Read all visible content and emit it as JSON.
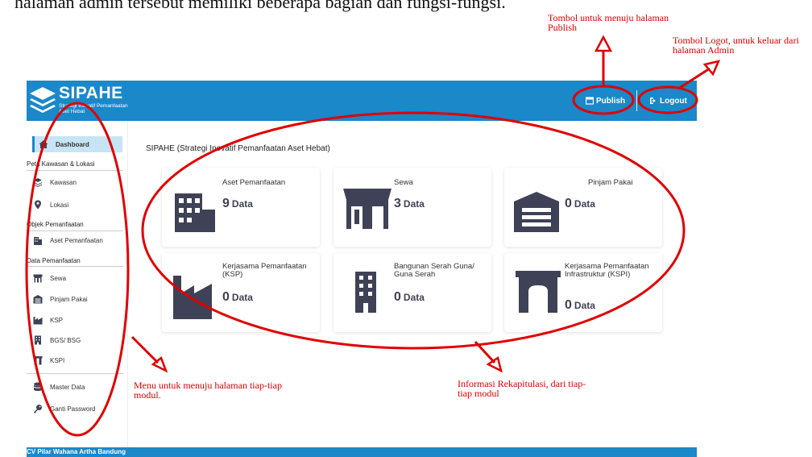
{
  "doc_line": "halaman admin tersebut memiliki beberapa bagian dan fungsi-fungsi.",
  "app": {
    "brand": "SIPAHE",
    "brand_sub": "Strategi Inovatif Pemanfaatan Aset Hebat",
    "publish_label": "Publish",
    "logout_label": "Logout",
    "colors": {
      "primary": "#1a88c9",
      "active_bg": "#c6e4f3",
      "icon": "#3f4256",
      "annotation": "#e00000"
    }
  },
  "sidebar": {
    "dashboard": "Dashboard",
    "section_peta": "Peta Kawasan & Lokasi",
    "kawasan": "Kawasan",
    "lokasi": "Lokasi",
    "section_objek": "Objek Pemanfaatan",
    "aset": "Aset Pemanfaatan",
    "section_data": "Data Pemanfaatan",
    "sewa": "Sewa",
    "pinjam": "Pinjam Pakai",
    "ksp": "KSP",
    "bgs": "BGS/ BSG",
    "kspi": "KSPI",
    "master": "Master Data",
    "password": "Ganti Password"
  },
  "main": {
    "title": "SIPAHE (Strategi Inovatif Pemanfaatan Aset Hebat)",
    "unit": "Data",
    "cards": [
      {
        "title": "Aset Pemanfaatan",
        "value": "9",
        "icon": "buildings-icon"
      },
      {
        "title": "Sewa",
        "value": "3",
        "icon": "shop-icon"
      },
      {
        "title": "Pinjam Pakai",
        "value": "0",
        "icon": "warehouse-icon"
      },
      {
        "title": "Kerjasama Pemanfaatan (KSP)",
        "value": "0",
        "icon": "industry-icon"
      },
      {
        "title": "Bangunan Serah Guna/ Guna Serah",
        "value": "0",
        "icon": "building-icon"
      },
      {
        "title": "Kerjasama Pemanfaatan Infrastruktur (KSPI)",
        "value": "0",
        "icon": "archway-icon"
      }
    ]
  },
  "footer": {
    "text": "CV Pilar Wahana Artha Bandung"
  },
  "annotations": {
    "publish": "Tombol untuk menuju halaman Publish",
    "logout": "Tombol Logot, untuk keluar dari halaman Admin",
    "menu": "Menu untuk menuju halaman tiap-tiap modul.",
    "info": "Informasi Rekapitulasi, dari tiap-tiap modul"
  }
}
